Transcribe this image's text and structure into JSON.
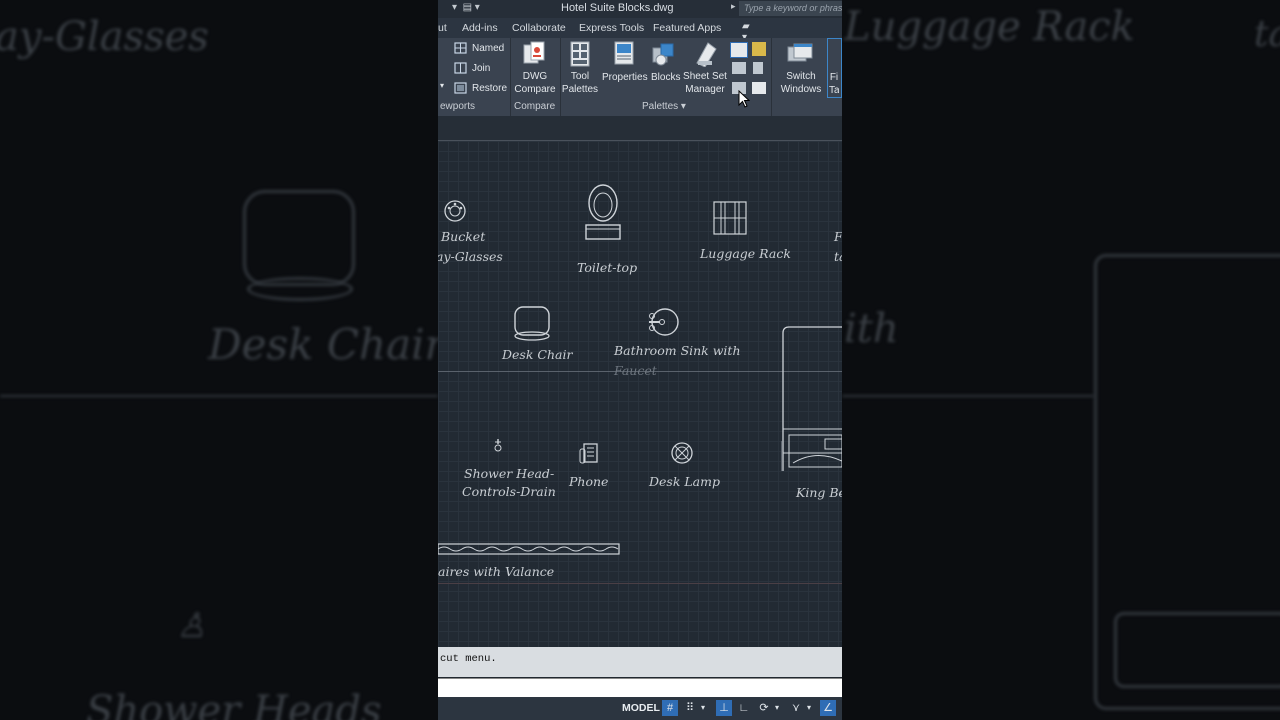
{
  "backdrop": {
    "left_texts": [
      "ay-Glasses",
      "Desk Chair",
      "Shower Heads"
    ],
    "right_texts": [
      "Luggage Rack",
      "ta",
      "ith"
    ]
  },
  "titlebar": {
    "title": "Hotel Suite Blocks.dwg",
    "search_placeholder": "Type a keyword or phrase"
  },
  "tabs": [
    "ut",
    "Add-ins",
    "Collaborate",
    "Express Tools",
    "Featured Apps"
  ],
  "ribbon": {
    "viewports": {
      "items": [
        "Named",
        "Join",
        "Restore"
      ],
      "footer": "ewports"
    },
    "compare": {
      "button": "DWG Compare",
      "footer": "Compare"
    },
    "palettes": {
      "tool_palettes": "Tool Palettes",
      "properties": "Properties",
      "blocks": "Blocks",
      "sheet_set_manager": "Sheet Set Manager",
      "footer": "Palettes"
    },
    "interface": {
      "switch_windows": "Switch Windows",
      "partial": "Fi Ta"
    }
  },
  "canvas": {
    "labels": {
      "bucket": "Bucket",
      "tray_glasses": "ay-Glasses",
      "toilet_top": "Toilet-top",
      "luggage_rack": "Luggage Rack",
      "edge_top": "F",
      "edge_top2": "ta",
      "desk_chair": "Desk Chair",
      "bathroom_sink_1": "Bathroom Sink with",
      "bathroom_sink_2": "Faucet",
      "shower_head_1": "Shower Head-",
      "shower_head_2": "Controls-Drain",
      "phone": "Phone",
      "desk_lamp": "Desk Lamp",
      "king_bed": "King Bed",
      "drapes": "aires with Valance"
    }
  },
  "command": {
    "history": "cut menu."
  },
  "status": {
    "model": "MODEL"
  },
  "colors": {
    "canvas_bg": "#222a33",
    "ribbon_bg": "#3a4350",
    "accent": "#2f6db5"
  }
}
